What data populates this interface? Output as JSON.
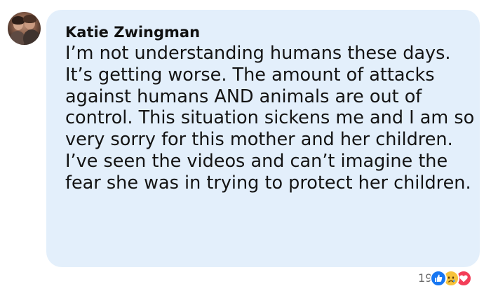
{
  "comment": {
    "author": "Katie Zwingman",
    "text": "I’m not understanding humans these days. It’s getting worse. The amount of attacks against humans AND animals are out of control. This situation sickens me and I am so very sorry for this mother and her children. I’ve seen the videos and can’t imagine the fear she was in trying to protect her children."
  },
  "reactions": {
    "count": "19",
    "icons": [
      "like-icon",
      "sad-icon",
      "love-icon"
    ]
  },
  "colors": {
    "bubble": "#e3effb",
    "like": "#1877f2",
    "sad": "#f7c33b",
    "love": "#f33e58"
  }
}
